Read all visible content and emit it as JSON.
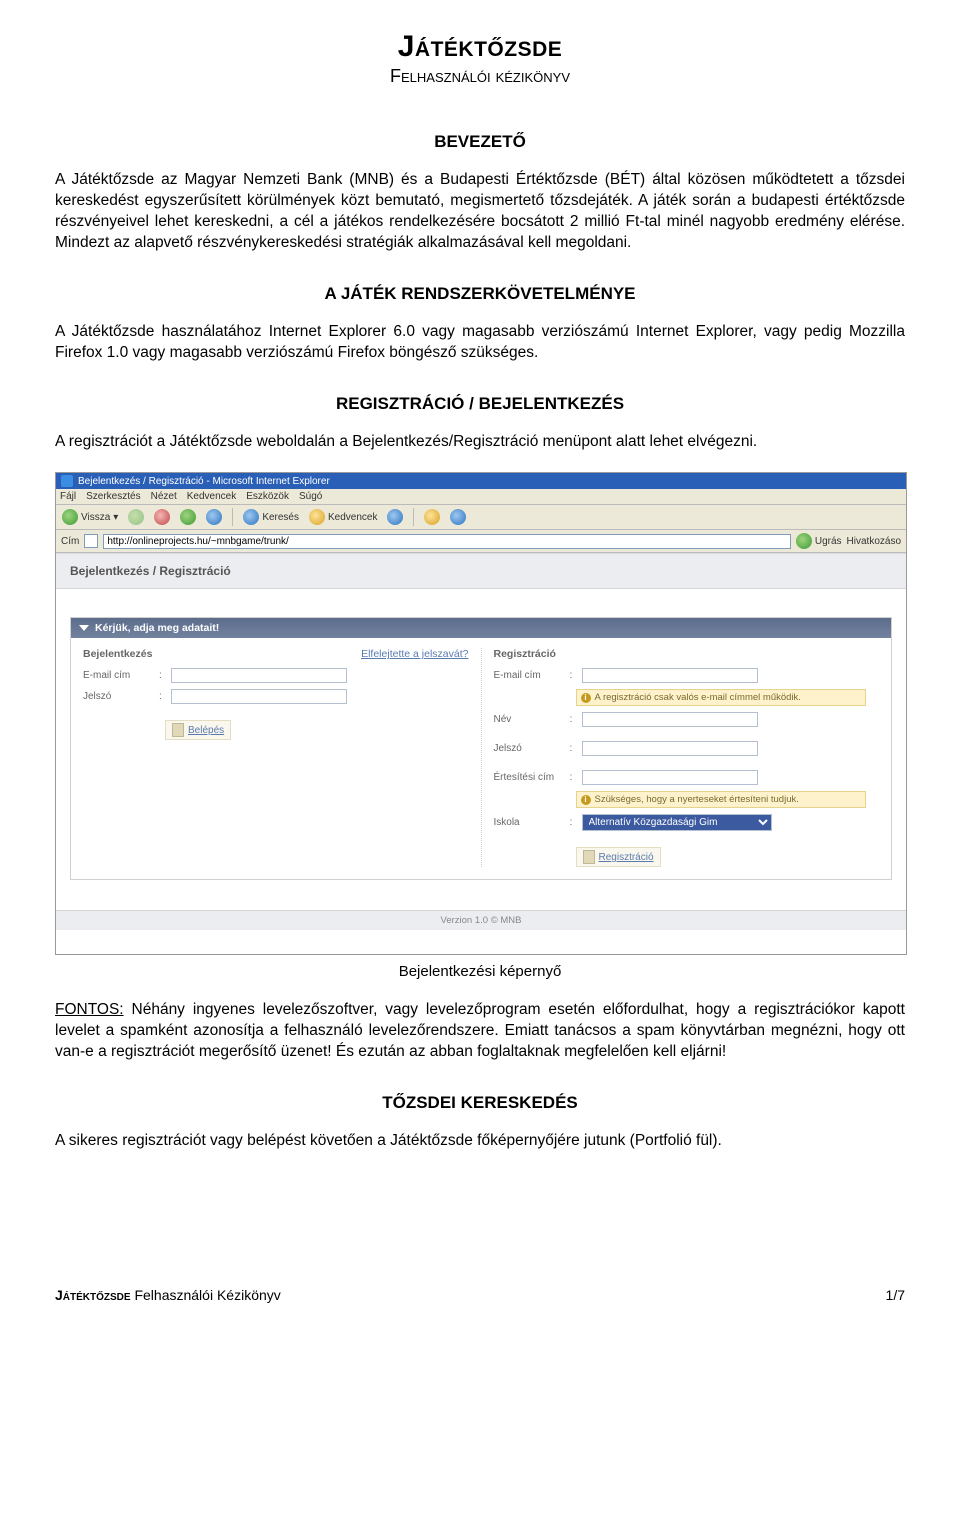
{
  "doc": {
    "title": "Játéktőzsde",
    "subtitle": "Felhasználói kézikönyv",
    "section1_heading": "BEVEZETŐ",
    "section1_body": "A Játéktőzsde az Magyar Nemzeti Bank (MNB) és a Budapesti Értéktőzsde (BÉT) által közösen működtetett a tőzsdei kereskedést egyszerűsített körülmények közt bemutató, megismertető tőzsdejáték. A játék során a budapesti értéktőzsde részvényeivel lehet kereskedni, a cél a játékos rendelkezésére bocsátott 2 millió Ft-tal minél nagyobb eredmény elérése. Mindezt az alapvető részvénykereskedési stratégiák alkalmazásával kell megoldani.",
    "section2_heading": "A JÁTÉK RENDSZERKÖVETELMÉNYE",
    "section2_body": "A Játéktőzsde használatához Internet Explorer 6.0 vagy magasabb verziószámú Internet Explorer, vagy pedig Mozzilla Firefox 1.0 vagy magasabb verziószámú Firefox böngésző szükséges.",
    "section3_heading": "REGISZTRÁCIÓ / BEJELENTKEZÉS",
    "section3_body": "A regisztrációt a Játéktőzsde weboldalán a Bejelentkezés/Regisztráció menüpont alatt lehet elvégezni.",
    "caption": "Bejelentkezési képernyő",
    "fontos_label": "FONTOS:",
    "fontos_body": " Néhány ingyenes levelezőszoftver, vagy levelezőprogram esetén előfordulhat, hogy a regisztrációkor kapott levelet a spamként azonosítja a felhasználó levelezőrendszere. Emiatt tanácsos a spam könyvtárban megnézni, hogy ott van-e a regisztrációt megerősítő üzenet! És ezután az abban foglaltaknak megfelelően kell eljárni!",
    "section4_heading": "TŐZSDEI KERESKEDÉS",
    "section4_body": "A sikeres regisztrációt vagy belépést követően a Játéktőzsde főképernyőjére jutunk (Portfolió fül).",
    "footer_title": "Játéktőzsde",
    "footer_sub": " Felhasználói Kézikönyv",
    "footer_page": "1/7"
  },
  "ie": {
    "window_title": "Bejelentkezés / Regisztráció - Microsoft Internet Explorer",
    "menu": [
      "Fájl",
      "Szerkesztés",
      "Nézet",
      "Kedvencek",
      "Eszközök",
      "Súgó"
    ],
    "tb_back": "Vissza",
    "tb_search": "Keresés",
    "tb_fav": "Kedvencek",
    "addr_label": "Cím",
    "addr_value": "http://onlineprojects.hu/~mnbgame/trunk/",
    "go_label": "Ugrás",
    "links_label": "Hivatkozáso",
    "version": "Verzion 1.0 © MNB"
  },
  "form": {
    "header": "Bejelentkezés / Regisztráció",
    "panel_title": "Kérjük, adja meg adatait!",
    "login_title": "Bejelentkezés",
    "forgot_link": "Elfelejtette a jelszavát?",
    "email_label": "E-mail cím",
    "password_label": "Jelszó",
    "login_action": "Belépés",
    "reg_title": "Regisztráció",
    "reg_email_label": "E-mail cím",
    "reg_info1": "A regisztráció csak valós e-mail címmel működik.",
    "name_label": "Név",
    "reg_password_label": "Jelszó",
    "notify_label": "Értesítési cím",
    "reg_info2": "Szükséges, hogy a nyerteseket értesíteni tudjuk.",
    "school_label": "Iskola",
    "school_value": "Alternatív Közgazdasági Gim",
    "reg_action": "Regisztráció"
  }
}
